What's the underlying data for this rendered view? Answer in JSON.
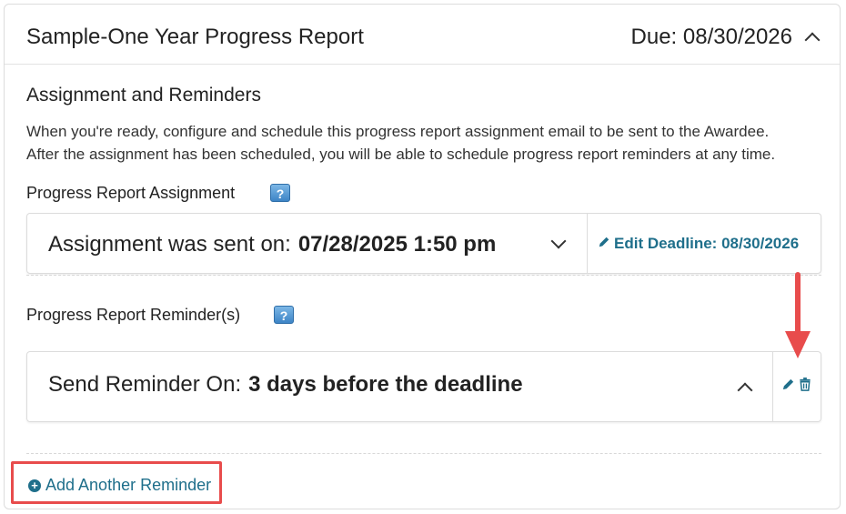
{
  "header": {
    "title": "Sample-One Year Progress Report",
    "due": "Due: 08/30/2026"
  },
  "section": {
    "title": "Assignment and Reminders",
    "desc_line1": "When you're ready, configure and schedule this progress report assignment email to be sent to the Awardee.",
    "desc_line2": "After the assignment has been scheduled, you will be able to schedule progress report reminders at any time."
  },
  "assignment": {
    "label": "Progress Report Assignment",
    "help": "?",
    "sent_prefix": "Assignment was sent on:",
    "sent_value": "07/28/2025 1:50 pm",
    "edit_deadline": "Edit Deadline: 08/30/2026"
  },
  "reminders": {
    "label": "Progress Report Reminder(s)",
    "help": "?",
    "reminder_prefix": "Send Reminder On:",
    "reminder_value": "3 days before the deadline",
    "add_label": "Add Another Reminder"
  },
  "colors": {
    "link": "#1f6f8b",
    "annotation": "#e84c4c",
    "help_badge": "#3d84c6"
  },
  "icons": [
    "chevron-up-icon",
    "chevron-down-icon",
    "help-icon",
    "pencil-icon",
    "trash-icon",
    "plus-circle-icon",
    "arrow-down-icon"
  ]
}
